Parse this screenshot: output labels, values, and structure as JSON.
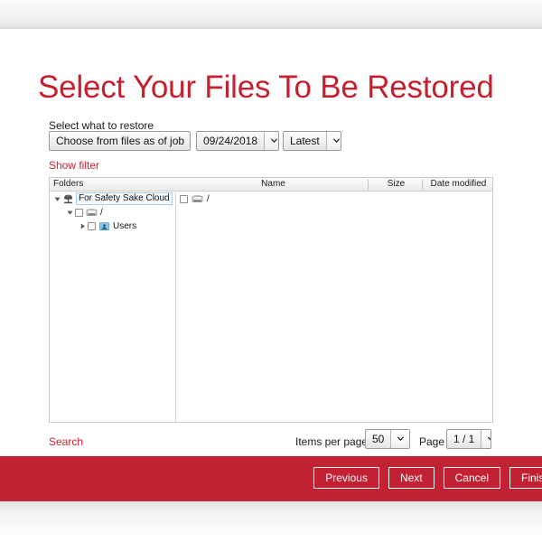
{
  "window": {
    "title": "Select Your Files To Be Restored"
  },
  "header": {
    "title": "Select Your Files To Be Restored",
    "accent_color": "#c6202f"
  },
  "restore_selector": {
    "label": "Select what to restore",
    "job_select": {
      "value": "Choose from files as of job",
      "icon": "chevron-down-icon"
    },
    "date_select": {
      "value": "09/24/2018",
      "icon": "chevron-down-icon"
    },
    "version_select": {
      "value": "Latest",
      "icon": "chevron-down-icon"
    },
    "show_filter_link": "Show filter"
  },
  "browser": {
    "columns": {
      "folders": "Folders",
      "name": "Name",
      "size": "Size",
      "date_modified": "Date modified"
    },
    "tree": [
      {
        "label": "For Safety Sake Cloud",
        "level": 0,
        "expanded": true,
        "selected": true,
        "has_checkbox": false,
        "icon": "cloud-icon"
      },
      {
        "label": "/",
        "level": 1,
        "expanded": true,
        "selected": false,
        "has_checkbox": true,
        "icon": "disk-icon"
      },
      {
        "label": "Users",
        "level": 2,
        "expanded": false,
        "selected": false,
        "has_checkbox": true,
        "icon": "users-folder-icon"
      }
    ],
    "list_rows": [
      {
        "name": "/",
        "size": "",
        "date_modified": "",
        "icon": "disk-icon",
        "checked": false
      }
    ]
  },
  "bottom_controls": {
    "search_link": "Search",
    "items_per_page_label": "Items per page",
    "items_per_page_value": "50",
    "page_label": "Page",
    "page_value": "1 / 1"
  },
  "footer": {
    "background_color": "#c22033",
    "buttons": [
      {
        "label": "Previous"
      },
      {
        "label": "Next"
      },
      {
        "label": "Cancel"
      },
      {
        "label": "Finish"
      }
    ]
  }
}
